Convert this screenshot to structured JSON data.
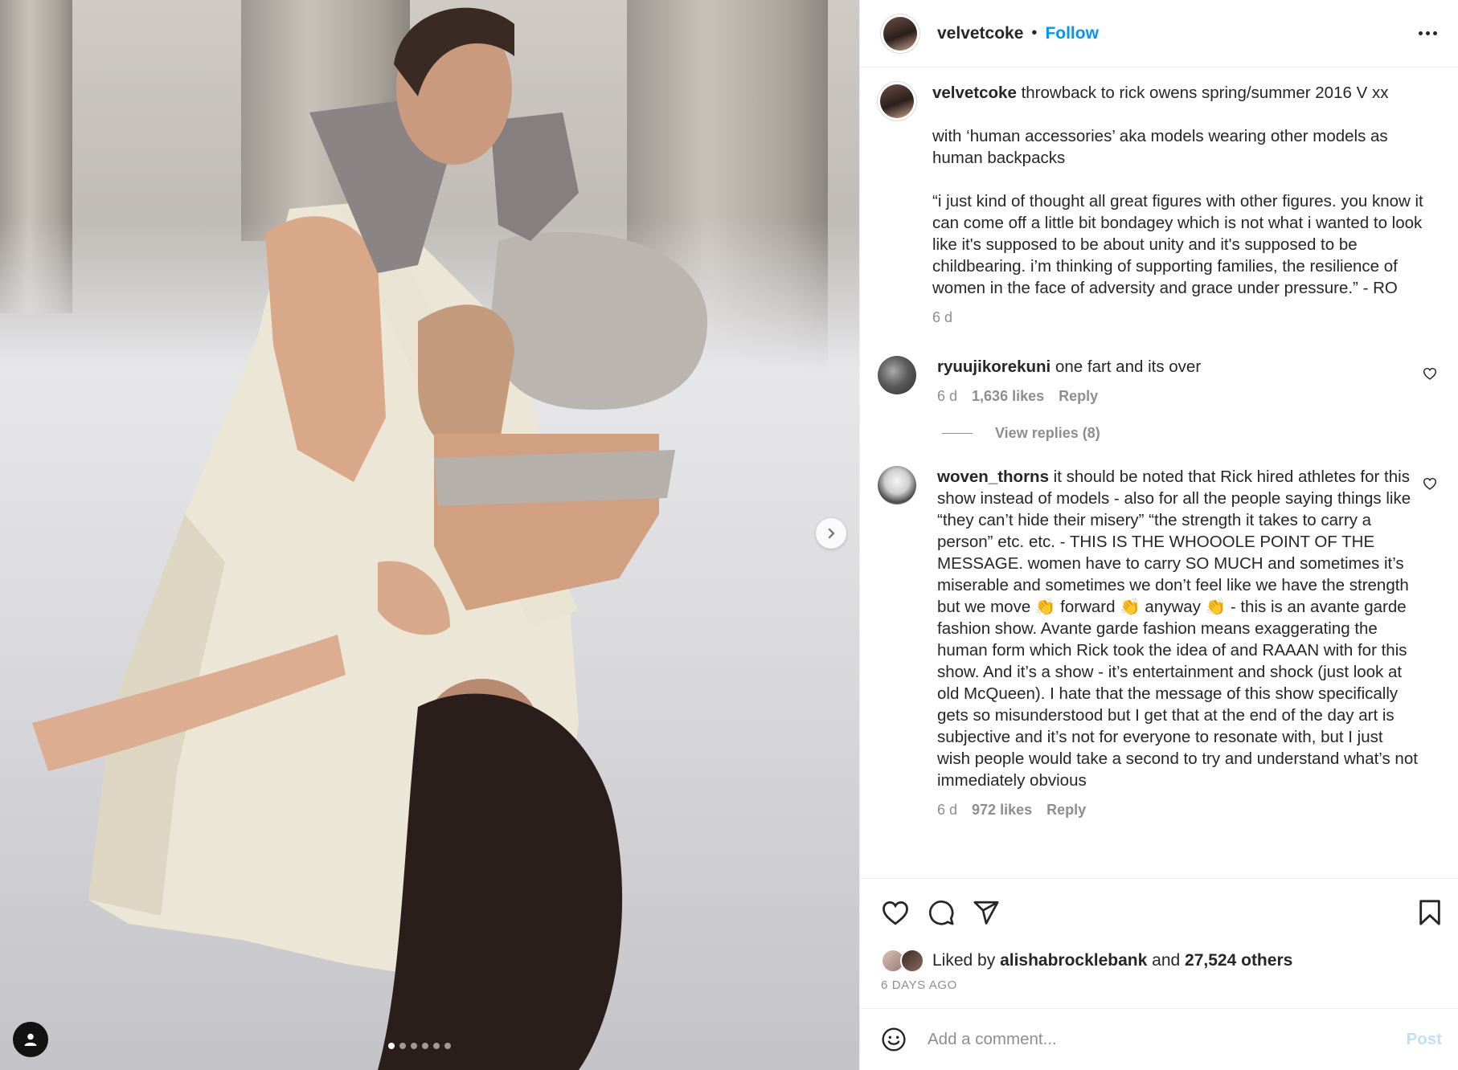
{
  "colors": {
    "link": "#0095f6",
    "text": "#262626",
    "muted": "#8e8e8e",
    "post_disabled": "#c0dffd"
  },
  "post": {
    "author": "velvetcoke",
    "follow_label": "Follow",
    "separator": "•",
    "carousel": {
      "slides": 6,
      "active_index": 0
    }
  },
  "caption": {
    "username": "velvetcoke",
    "paragraphs": [
      "throwback to rick owens spring/summer 2016 V xx",
      "with ‘human accessories’ aka models wearing other models as human backpacks",
      "“i just kind of thought all great figures with other figures. you know it can come off a little bit bondagey which is not what i wanted to look like it's supposed to be about unity and it's supposed to be childbearing. i’m thinking of supporting families, the resilience of women in the face of adversity and grace under pressure.” - RO"
    ],
    "time": "6 d"
  },
  "comments": [
    {
      "username": "ryuujikorekuni",
      "text": "one fart and its over",
      "time": "6 d",
      "likes": "1,636 likes",
      "reply_label": "Reply",
      "view_replies": "View replies (8)"
    },
    {
      "username": "woven_thorns",
      "text": "it should be noted that Rick hired athletes for this show instead of models - also for all the people saying things like “they can’t hide their misery” “the strength it takes to carry a person” etc. etc. - THIS IS THE WHOOOLE POINT OF THE MESSAGE. women have to carry SO MUCH and sometimes it’s miserable and sometimes we don’t feel like we have the strength but we move 👏 forward 👏 anyway 👏 - this is an avante garde fashion show. Avante garde fashion means exaggerating the human form which Rick took the idea of and RAAAN with for this show. And it’s a show - it’s entertainment and shock (just look at old McQueen). I hate that the message of this show specifically gets so misunderstood but I get that at the end of the day art is subjective and it’s not for everyone to resonate with, but I just wish people would take a second to try and understand what’s not immediately obvious",
      "time": "6 d",
      "likes": "972 likes",
      "reply_label": "Reply"
    }
  ],
  "likes": {
    "prefix": "Liked by",
    "user": "alishabrocklebank",
    "conjunction": "and",
    "others": "27,524 others",
    "date": "6 DAYS AGO"
  },
  "add_comment": {
    "placeholder": "Add a comment...",
    "post_label": "Post"
  },
  "icons": {
    "header_more": "more-horizontal-icon",
    "like": "heart-icon",
    "comment": "comment-bubble-icon",
    "share": "paper-plane-icon",
    "save": "bookmark-icon",
    "emoji": "emoji-smile-icon",
    "next": "chevron-right-icon",
    "tagged": "user-tag-icon"
  }
}
